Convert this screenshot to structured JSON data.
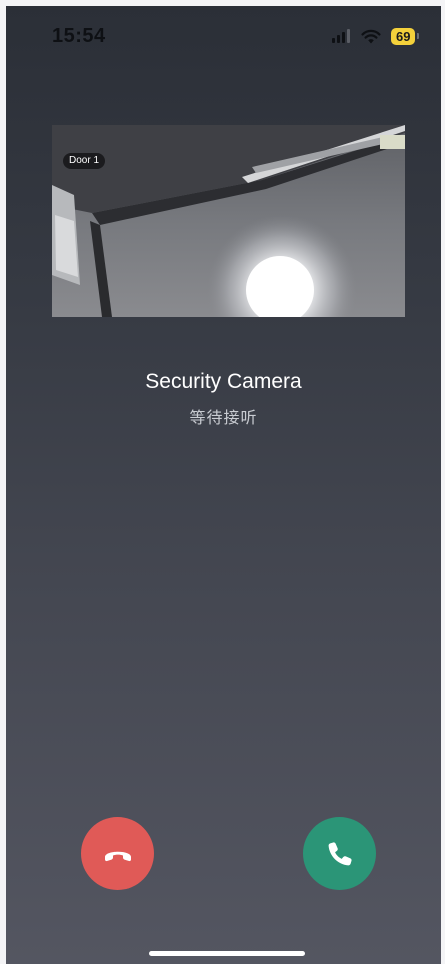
{
  "status_bar": {
    "time": "15:54",
    "battery_level": "69",
    "signal_icon": "cellular-signal-icon",
    "wifi_icon": "wifi-icon",
    "battery_color": "#f4d13b"
  },
  "camera": {
    "badge_label": "Door 1"
  },
  "caller": {
    "name": "Security Camera",
    "status": "等待接听"
  },
  "actions": {
    "decline_icon": "hang-up-icon",
    "decline_color": "#e05a57",
    "accept_icon": "phone-icon",
    "accept_color": "#2b9577"
  }
}
